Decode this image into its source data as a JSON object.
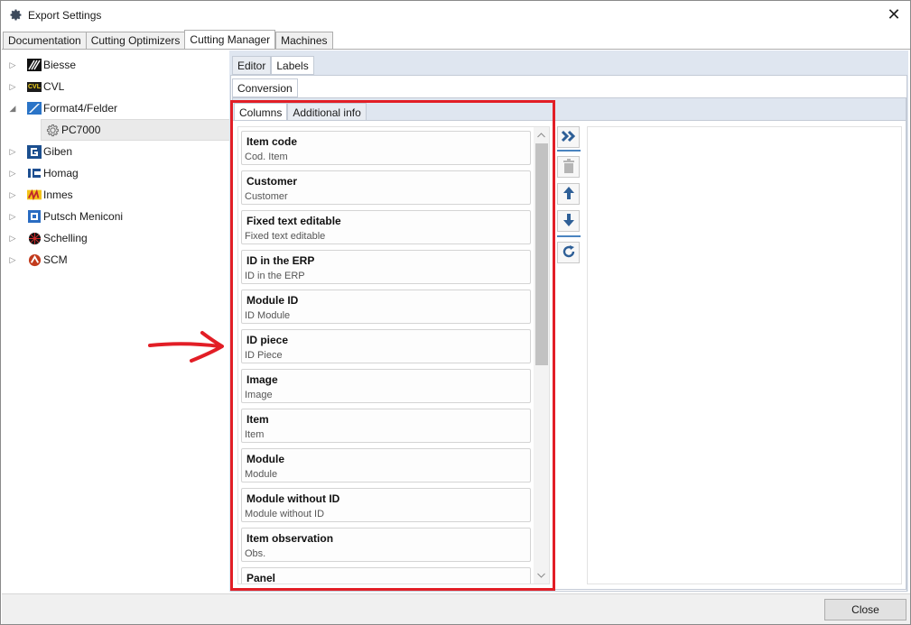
{
  "window": {
    "title": "Export Settings",
    "close_glyph": "✕"
  },
  "top_tabs": [
    "Documentation",
    "Cutting Optimizers",
    "Cutting Manager",
    "Machines"
  ],
  "tree": [
    {
      "label": "Biesse",
      "expander": "▷",
      "icon": "biesse-logo-icon"
    },
    {
      "label": "CVL",
      "expander": "▷",
      "icon": "cvl-logo-icon",
      "icon_text": "CVL"
    },
    {
      "label": "Format4/Felder",
      "expander": "◢",
      "icon": "format4-logo-icon"
    },
    {
      "label": "PC7000",
      "expander": "",
      "icon": "gear-icon"
    },
    {
      "label": "Giben",
      "expander": "▷",
      "icon": "giben-logo-icon"
    },
    {
      "label": "Homag",
      "expander": "▷",
      "icon": "homag-logo-icon"
    },
    {
      "label": "Inmes",
      "expander": "▷",
      "icon": "inmes-logo-icon"
    },
    {
      "label": "Putsch Meniconi",
      "expander": "▷",
      "icon": "putsch-logo-icon"
    },
    {
      "label": "Schelling",
      "expander": "▷",
      "icon": "schelling-logo-icon"
    },
    {
      "label": "SCM",
      "expander": "▷",
      "icon": "scm-logo-icon"
    }
  ],
  "panel_tabs": {
    "level1": [
      "Editor",
      "Labels"
    ],
    "level2": [
      "Conversion"
    ],
    "level3": [
      "Columns",
      "Additional info"
    ]
  },
  "columns": [
    {
      "title": "Item code",
      "sub": "Cod. Item"
    },
    {
      "title": "Customer",
      "sub": "Customer"
    },
    {
      "title": "Fixed text editable",
      "sub": "Fixed text editable"
    },
    {
      "title": "ID in the ERP",
      "sub": "ID in the ERP"
    },
    {
      "title": "Module ID",
      "sub": "ID Module"
    },
    {
      "title": "ID piece",
      "sub": "ID Piece"
    },
    {
      "title": "Image",
      "sub": "Image"
    },
    {
      "title": "Item",
      "sub": "Item"
    },
    {
      "title": "Module",
      "sub": "Module"
    },
    {
      "title": "Module without ID",
      "sub": "Module without ID"
    },
    {
      "title": "Item observation",
      "sub": "Obs."
    },
    {
      "title": "Panel",
      "sub": ""
    }
  ],
  "toolbar": [
    "add-all-icon",
    "delete-icon",
    "move-up-icon",
    "move-down-icon",
    "refresh-icon"
  ],
  "colors": {
    "accent_blue": "#2e5f97",
    "highlight_red": "#e21e26"
  },
  "footer": {
    "close_label": "Close"
  }
}
